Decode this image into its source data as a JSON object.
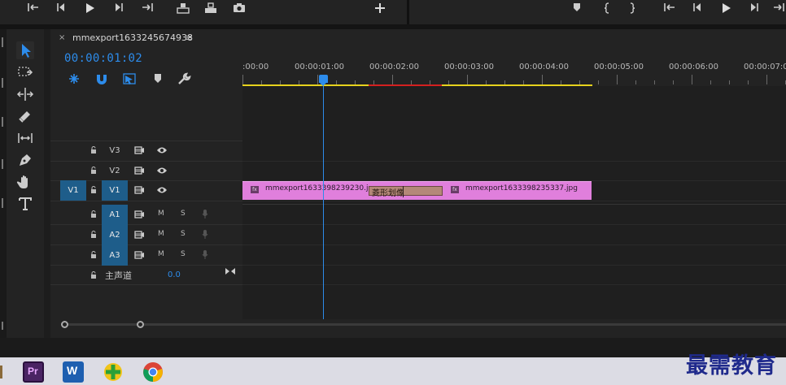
{
  "app": {
    "accent_color": "#2d8ceb",
    "clip_color": "#e07fdc",
    "transition_color": "#b48878"
  },
  "transport_left": [
    {
      "name": "mark-in",
      "icon": "mark-in-icon"
    },
    {
      "name": "step-back",
      "icon": "step-back-icon"
    },
    {
      "name": "play",
      "icon": "play-icon"
    },
    {
      "name": "step-forward",
      "icon": "step-forward-icon"
    },
    {
      "name": "mark-out",
      "icon": "mark-out-icon"
    },
    {
      "name": "insert",
      "icon": "insert-icon"
    },
    {
      "name": "overwrite",
      "icon": "overwrite-icon"
    },
    {
      "name": "export-frame",
      "icon": "camera-icon"
    },
    {
      "name": "add-button",
      "icon": "plus-icon"
    }
  ],
  "sequence": {
    "tab_close": "×",
    "name": "mmexport1633245674938",
    "menu_glyph": "≡",
    "timecode": "00:00:01:02"
  },
  "ruler": {
    "labels": [
      ":00:00",
      "00:00:01:00",
      "00:00:02:00",
      "00:00:03:00",
      "00:00:04:00",
      "00:00:05:00",
      "00:00:06:00",
      "00:00:07:0"
    ]
  },
  "tracks": {
    "video": [
      {
        "name": "V3",
        "source": ""
      },
      {
        "name": "V2",
        "source": ""
      },
      {
        "name": "V1",
        "source": "V1"
      }
    ],
    "audio": [
      {
        "name": "A1",
        "m": "M",
        "s": "S"
      },
      {
        "name": "A2",
        "m": "M",
        "s": "S"
      },
      {
        "name": "A3",
        "m": "M",
        "s": "S"
      }
    ],
    "master": {
      "name": "主声道",
      "value": "0.0"
    }
  },
  "clips": {
    "clip1": {
      "fx": "fx",
      "name": "mmexport1633398239230.jpg"
    },
    "transition": {
      "name": "菱形划像"
    },
    "clip2": {
      "fx": "fx",
      "name": "mmexport1633398235337.jpg"
    }
  },
  "taskbar": {
    "apps": [
      "premiere-pro",
      "word",
      "360-safe",
      "chrome"
    ],
    "premiere_label": "Pr",
    "word_label": "W"
  },
  "watermark": "最需教育"
}
